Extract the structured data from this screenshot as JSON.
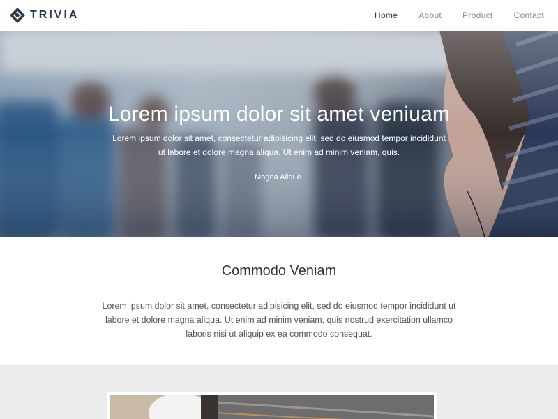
{
  "brand": {
    "name": "TRIVIA",
    "logo_icon": "diamond-logo-icon"
  },
  "nav": {
    "items": [
      {
        "label": "Home",
        "active": true
      },
      {
        "label": "About",
        "active": false
      },
      {
        "label": "Product",
        "active": false
      },
      {
        "label": "Contact",
        "active": false
      }
    ]
  },
  "hero": {
    "title": "Lorem ipsum dolor sit amet veniuam",
    "text": "Lorem ipsum dolor sit amet, consectetur adipisicing elit, sed do eiusmod tempor incididunt ut labore et dolore magna aliqua. Ut enim ad minim veniam, quis.",
    "button_label": "Magna Alique"
  },
  "section": {
    "title": "Commodo Veniam",
    "text": "Lorem ipsum dolor sit amet, consectetur adipisicing elit, sed do eiusmod tempor incididunt ut labore et dolore magna aliqua. Ut enim ad minim veniam, quis nostrud exercitation ullamco laboris nisi ut aliquip ex ea commodo consequat."
  },
  "colors": {
    "brand": "#2b3a4a",
    "nav_active": "#3a3a3a",
    "nav_inactive": "#8b8b8b",
    "gallery_bg": "#ececec"
  }
}
